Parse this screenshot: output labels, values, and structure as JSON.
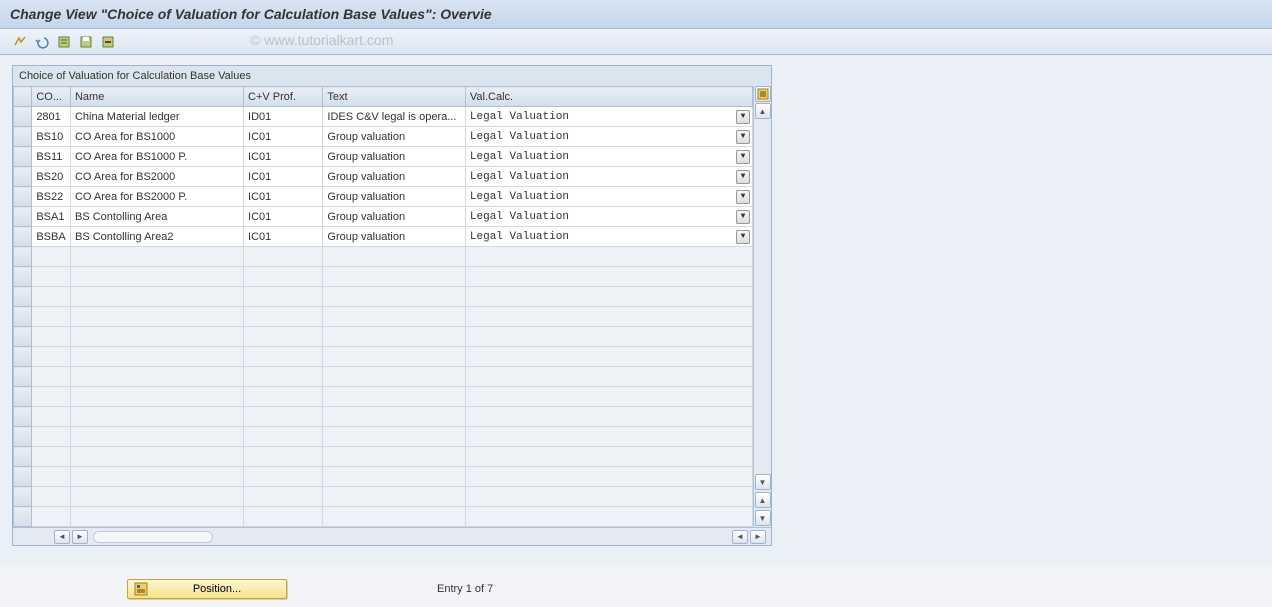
{
  "header": {
    "title": "Change View \"Choice of Valuation for Calculation Base Values\": Overvie"
  },
  "watermark": "© www.tutorialkart.com",
  "toolbar": {
    "icons": [
      "other-view",
      "undo",
      "select-all",
      "save",
      "delete-row"
    ]
  },
  "panel": {
    "title": "Choice of Valuation for Calculation Base Values"
  },
  "columns": {
    "co": "CO...",
    "name": "Name",
    "cvprof": "C+V Prof.",
    "text": "Text",
    "valcalc": "Val.Calc."
  },
  "rows": [
    {
      "co": "2801",
      "name": "China Material ledger",
      "cvprof": "ID01",
      "text": "IDES C&V legal is opera...",
      "valcalc": "Legal Valuation"
    },
    {
      "co": "BS10",
      "name": "CO Area for BS1000",
      "cvprof": "IC01",
      "text": "Group valuation",
      "valcalc": "Legal Valuation"
    },
    {
      "co": "BS11",
      "name": "CO Area for BS1000 P.",
      "cvprof": "IC01",
      "text": "Group valuation",
      "valcalc": "Legal Valuation"
    },
    {
      "co": "BS20",
      "name": "CO Area for BS2000",
      "cvprof": "IC01",
      "text": "Group valuation",
      "valcalc": "Legal Valuation"
    },
    {
      "co": "BS22",
      "name": "CO Area for BS2000 P.",
      "cvprof": "IC01",
      "text": "Group valuation",
      "valcalc": "Legal Valuation"
    },
    {
      "co": "BSA1",
      "name": "BS Contolling Area",
      "cvprof": "IC01",
      "text": "Group valuation",
      "valcalc": "Legal Valuation"
    },
    {
      "co": "BSBA",
      "name": "BS Contolling Area2",
      "cvprof": "IC01",
      "text": "Group valuation",
      "valcalc": "Legal Valuation"
    }
  ],
  "empty_rows": 14,
  "footer": {
    "position_label": "Position...",
    "entry_text": "Entry 1 of 7"
  }
}
